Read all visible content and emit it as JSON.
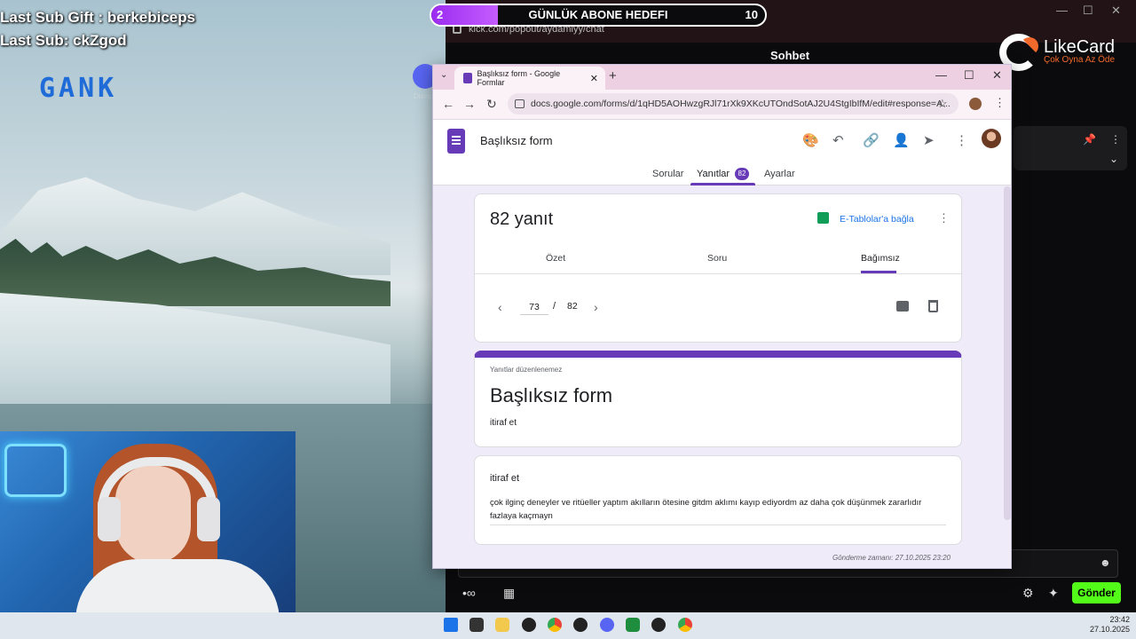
{
  "overlay": {
    "last_sub_gift": "Last Sub Gift : berkebiceps",
    "last_sub": "Last Sub: ckZgod",
    "gank_logo": "GANK"
  },
  "goal": {
    "current": "2",
    "title": "GÜNLÜK ABONE HEDEFI",
    "target": "10",
    "progress_fraction": 0.2,
    "fill_color": "#9b2cf0"
  },
  "kick": {
    "url": "kick.com/popout/aydamiyy/chat",
    "chat_title": "Sohbet",
    "send_label": "Gönder",
    "accent_color": "#53fc18"
  },
  "likecard": {
    "name": "LikeCard",
    "slogan": "Çok Oyna  Az Öde"
  },
  "discord": {
    "label": "Disco"
  },
  "browser": {
    "tab_title": "Başlıksız form - Google Formlar",
    "url": "docs.google.com/forms/d/1qHD5AOHwzgRJl71rXk9XKcUTOndSotAJ2U4StgIbIfM/edit#response=A..."
  },
  "form": {
    "header_title": "Başlıksız form",
    "tabs": [
      {
        "label": "Sorular"
      },
      {
        "label": "Yanıtlar",
        "badge": "82"
      },
      {
        "label": "Ayarlar"
      }
    ],
    "accent_color": "#673ab7",
    "responses": {
      "count_label": "82 yanıt",
      "sheets_link": "E-Tablolar'a bağla",
      "subtabs": [
        "Özet",
        "Soru",
        "Bağımsız"
      ],
      "current_page": "73",
      "page_sep": "/",
      "total_pages": "82"
    },
    "response_card": {
      "notice": "Yanıtlar düzenlenemez",
      "title": "Başlıksız form",
      "description": "itiraf et"
    },
    "question": {
      "title": "itiraf et",
      "answer": "çok ilginç deneyler ve ritüeller yaptım akılların ötesine gitdm aklımı kayıp ediyordm az daha çok düşünmek zararlıdır fazlaya kaçmayn"
    },
    "submitted": "Gönderme zamanı: 27.10.2025 23:20"
  },
  "taskbar": {
    "time": "23:42",
    "date": "27.10.2025"
  }
}
